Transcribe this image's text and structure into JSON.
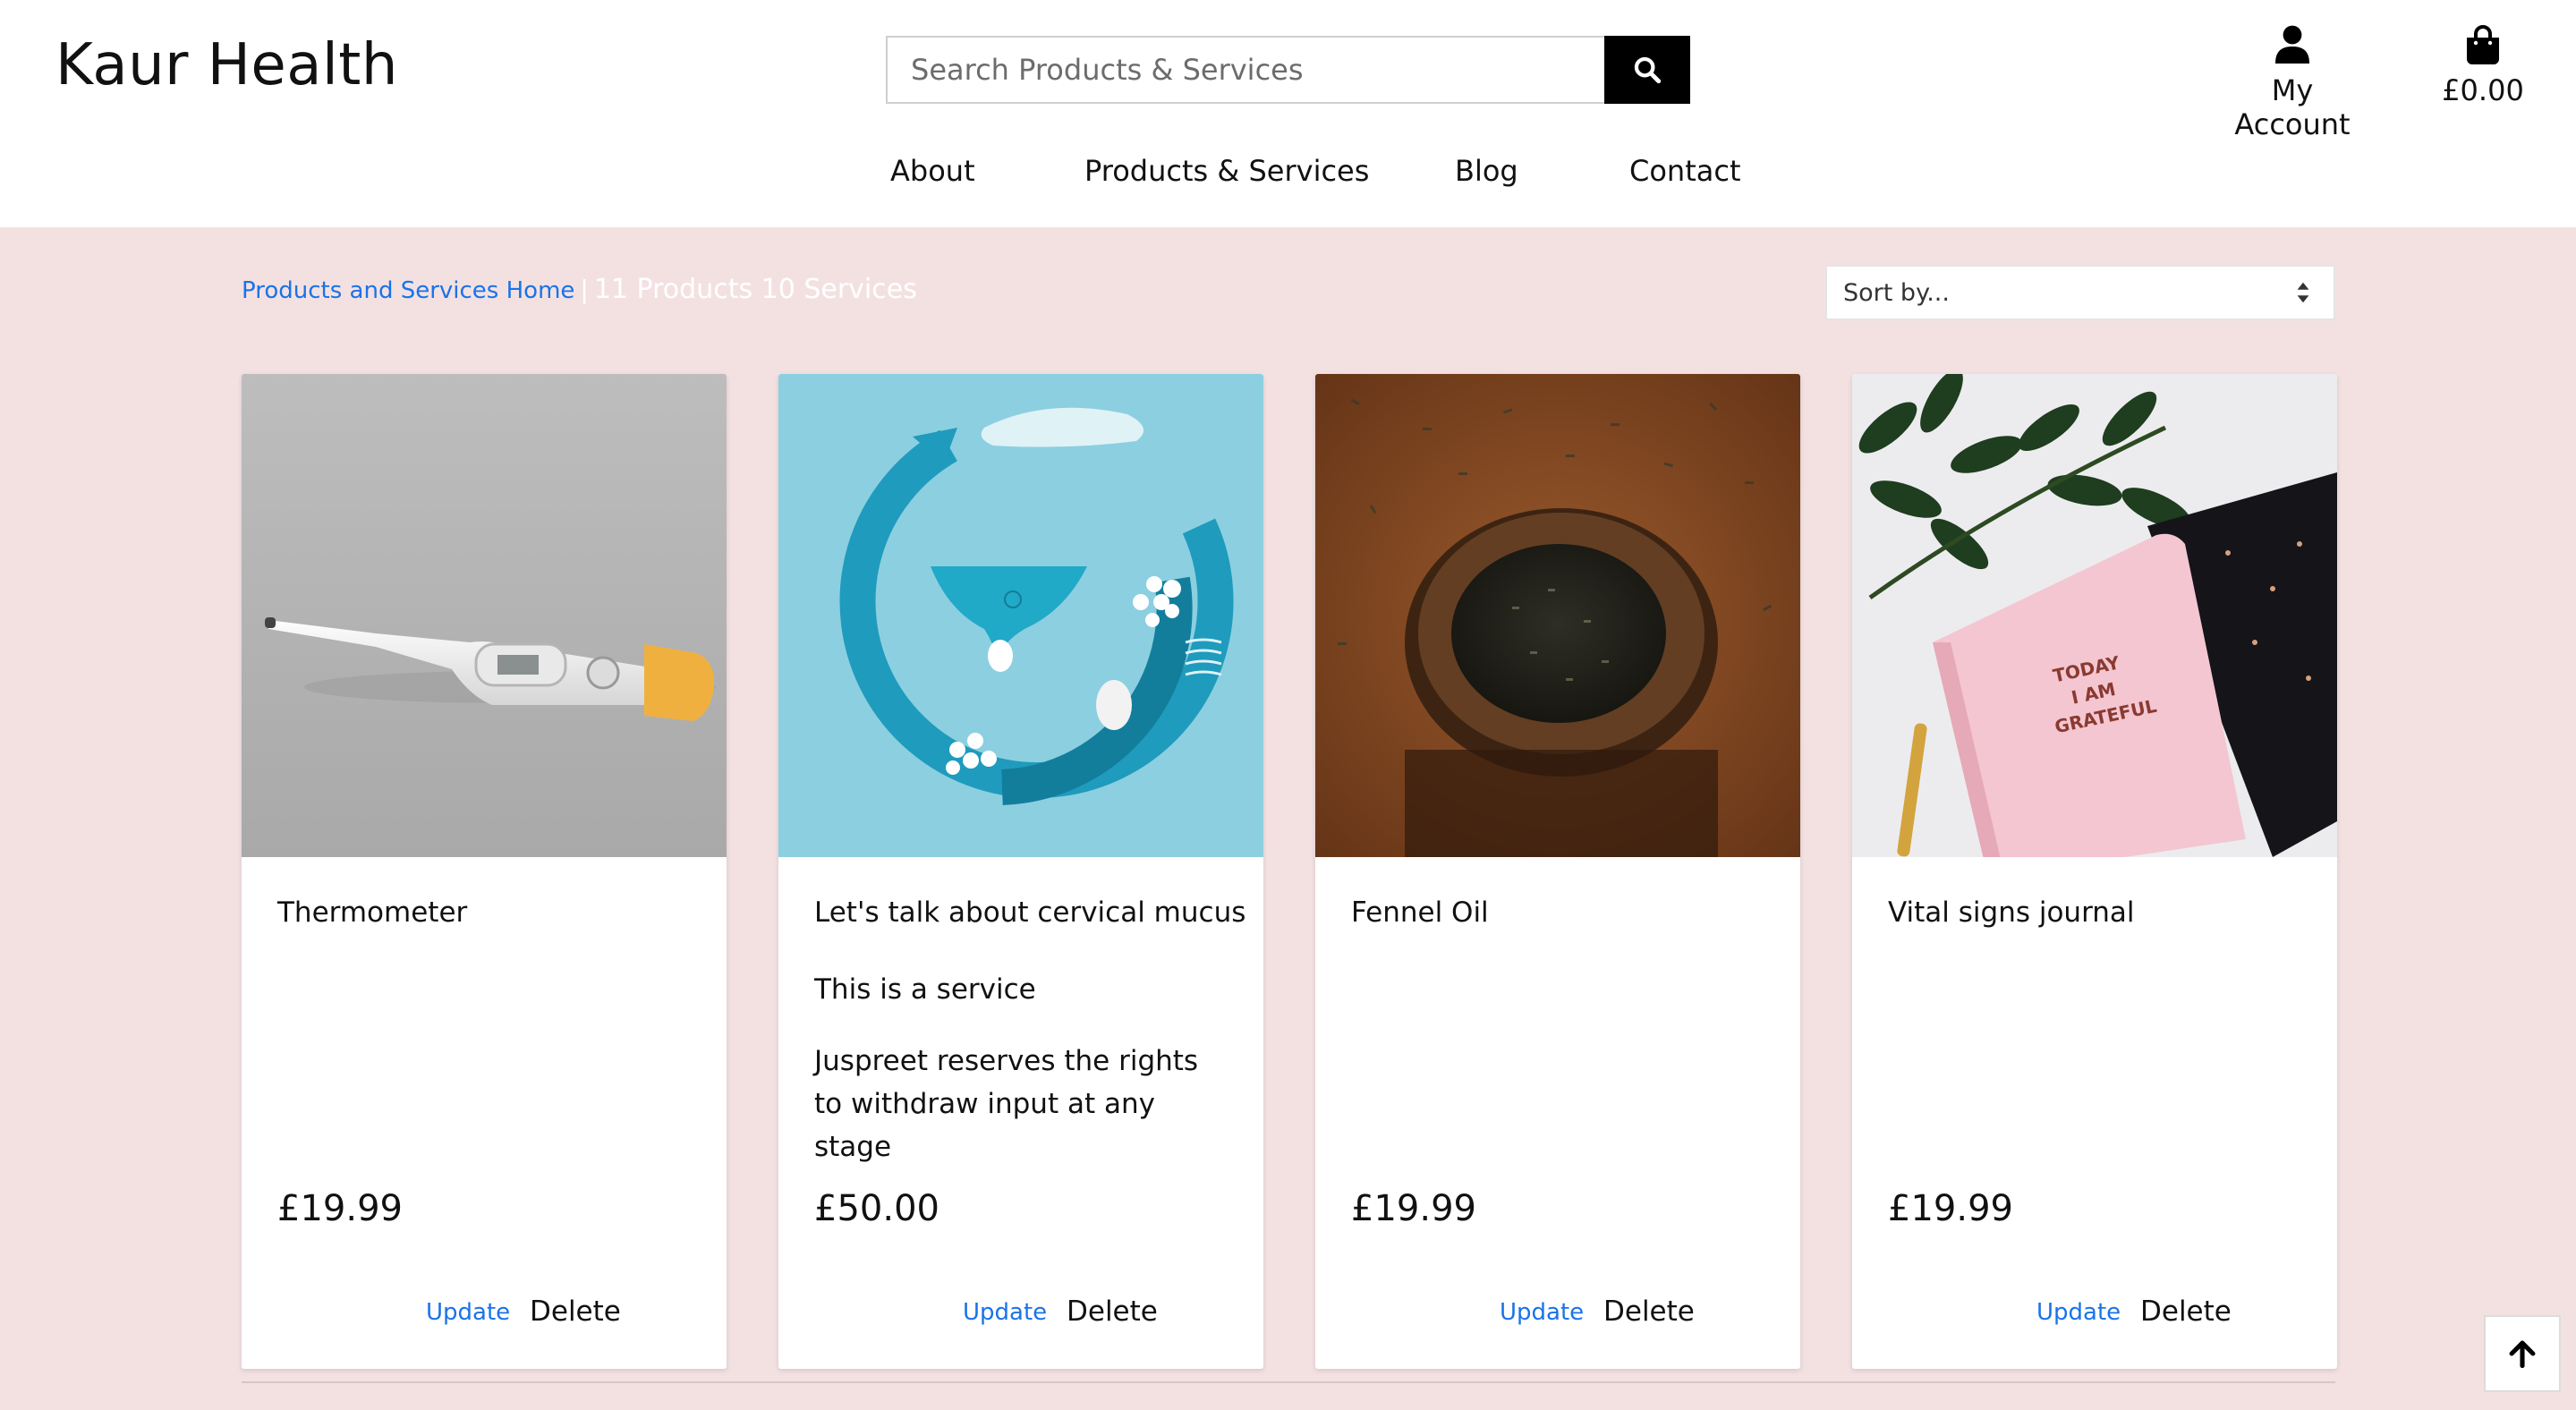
{
  "brand": "Kaur Health",
  "search": {
    "placeholder": "Search Products & Services",
    "icon": "search-icon"
  },
  "account": {
    "label": "My Account",
    "icon": "user-icon"
  },
  "bag": {
    "total": "£0.00",
    "icon": "shopping-bag-icon"
  },
  "nav": [
    "About",
    "Products & Services",
    "Blog",
    "Contact"
  ],
  "breadcrumb": {
    "link": "Products and Services Home",
    "separator": "|",
    "counts": "11 Products 10 Services"
  },
  "sort": {
    "selected": "Sort by..."
  },
  "colors": {
    "background": "#f3e1e2",
    "link": "#1a73e8",
    "header": "#ffffff",
    "search_button": "#000000"
  },
  "cards": [
    {
      "title": "Thermometer",
      "description": [],
      "price": "£19.99",
      "update": "Update",
      "delete": "Delete",
      "image": "thermometer-image"
    },
    {
      "title": "Let's talk about cervical mucus",
      "description": [
        "This is a service",
        "Juspreet reserves the rights to withdraw input at any stage"
      ],
      "price": "£50.00",
      "update": "Update",
      "delete": "Delete",
      "image": "cycle-illustration-image"
    },
    {
      "title": "Fennel Oil",
      "description": [],
      "price": "£19.99",
      "update": "Update",
      "delete": "Delete",
      "image": "fennel-jar-image"
    },
    {
      "title": "Vital signs journal",
      "description": [],
      "price": "£19.99",
      "update": "Update",
      "delete": "Delete",
      "image": "journal-image"
    }
  ],
  "back_to_top": {
    "icon": "arrow-up-icon"
  }
}
